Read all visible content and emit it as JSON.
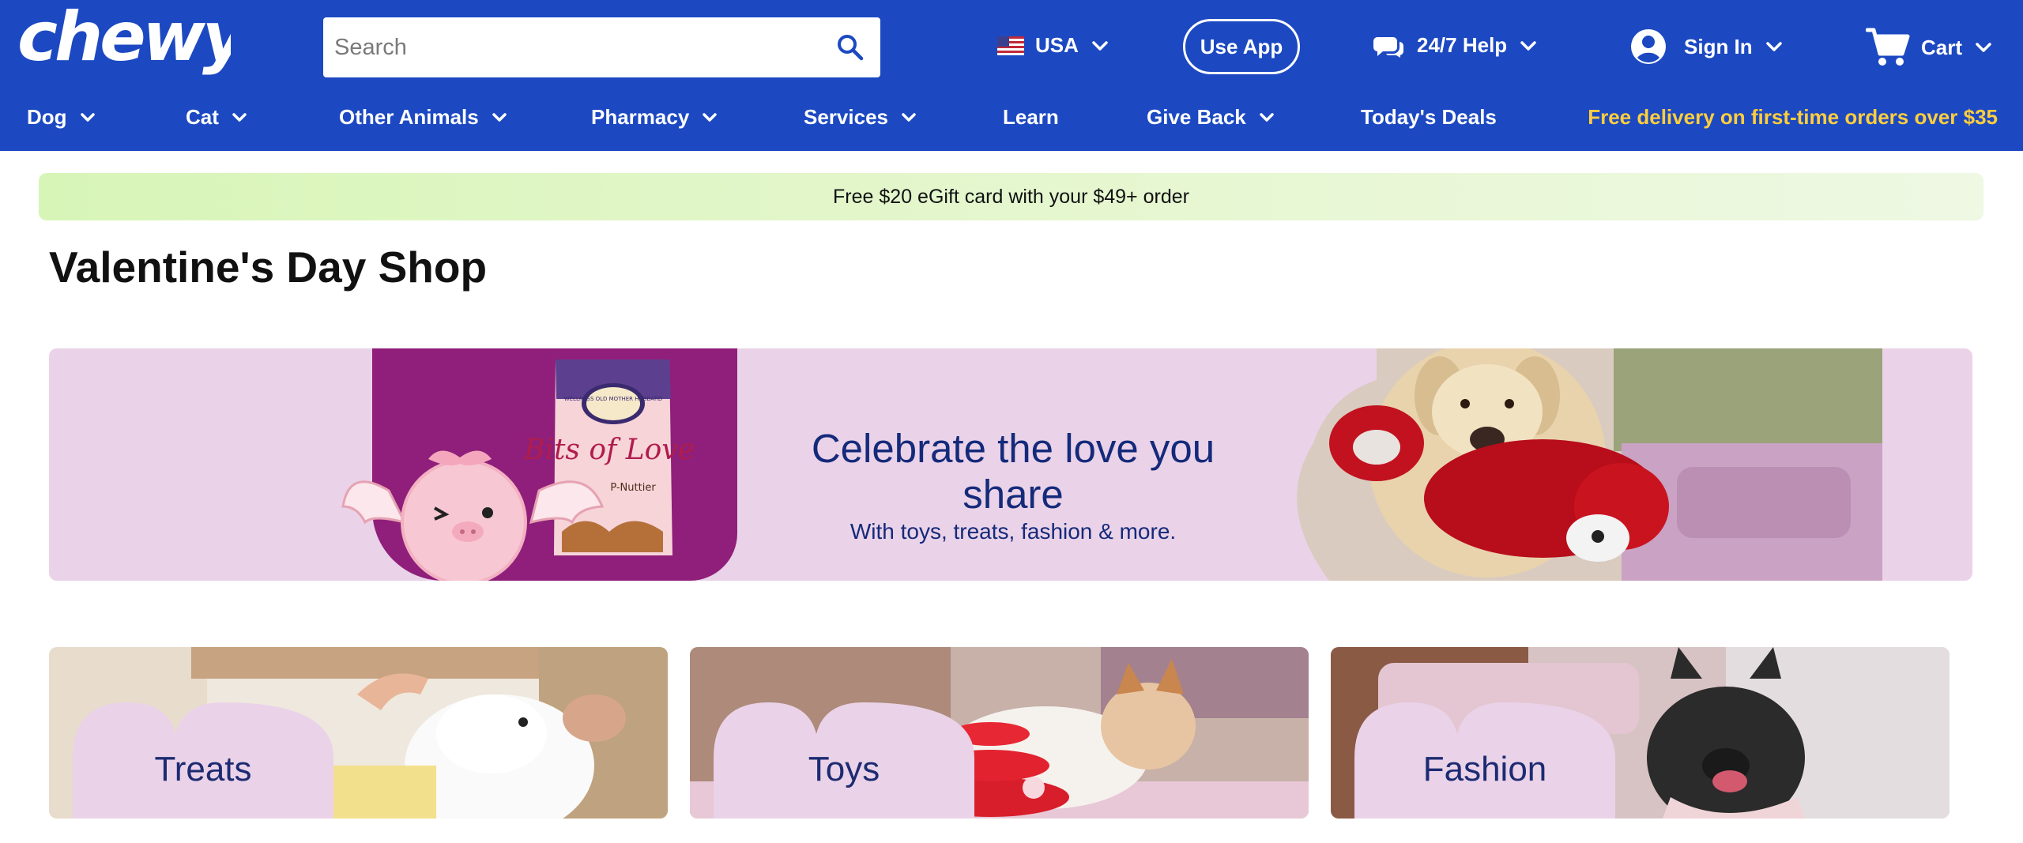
{
  "header": {
    "logo_text": "chewy",
    "search_placeholder": "Search",
    "country": "USA",
    "use_app": "Use App",
    "help": "24/7 Help",
    "sign_in": "Sign In",
    "cart": "Cart"
  },
  "nav": {
    "items": [
      {
        "label": "Dog"
      },
      {
        "label": "Cat"
      },
      {
        "label": "Other Animals"
      },
      {
        "label": "Pharmacy"
      },
      {
        "label": "Services"
      },
      {
        "label": "Learn"
      },
      {
        "label": "Give Back"
      },
      {
        "label": "Today's Deals"
      }
    ],
    "promo": "Free delivery on first-time orders over $35"
  },
  "gift_banner": "Free $20 eGift card with your $49+ order",
  "page_title": "Valentine's Day Shop",
  "hero": {
    "headline": "Celebrate the love you share",
    "subline": "With toys, treats, fashion & more.",
    "bag_text": "Bits of Love",
    "bag_brand": "WELLNESS OLD MOTHER HUBBARD",
    "bag_flavor": "P-Nuttier"
  },
  "categories": [
    {
      "label": "Treats"
    },
    {
      "label": "Toys"
    },
    {
      "label": "Fashion"
    }
  ],
  "colors": {
    "brand_blue": "#1c49c2",
    "promo_yellow": "#ffce3d",
    "hero_pink": "#ead2e8",
    "hero_magenta": "#8f1f7a",
    "headline_navy": "#142a7a"
  }
}
